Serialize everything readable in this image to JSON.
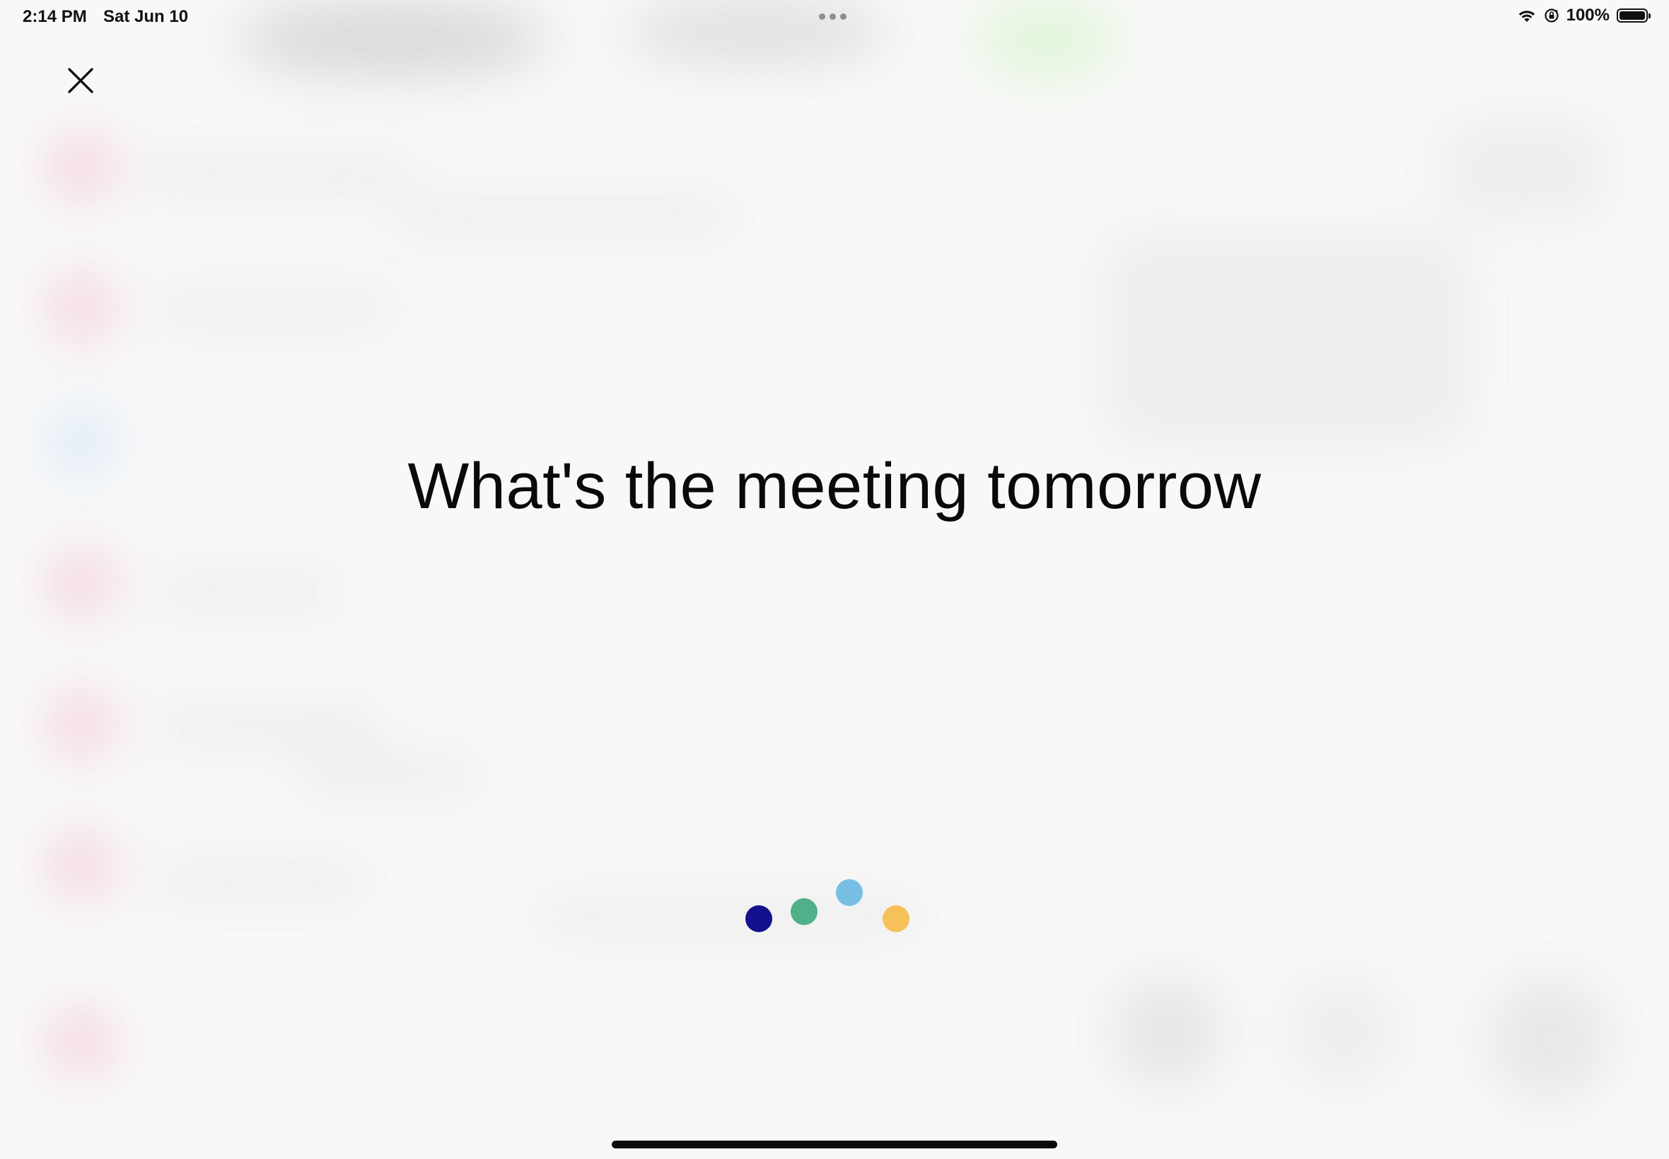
{
  "status_bar": {
    "time": "2:14 PM",
    "date": "Sat Jun 10",
    "battery_percent": "100%",
    "battery_level": 1.0,
    "icons": [
      "wifi-icon",
      "orientation-lock-icon",
      "battery-icon"
    ]
  },
  "close": {
    "icon": "close-icon"
  },
  "siri": {
    "query": "What's the meeting tomorrow",
    "dot_colors": [
      "#14118f",
      "#4fb08a",
      "#78bfe6",
      "#f5c158"
    ]
  },
  "colors": {
    "background": "#f8f8f8",
    "text": "#0a0a0a",
    "home_indicator": "#0a0a0a"
  }
}
